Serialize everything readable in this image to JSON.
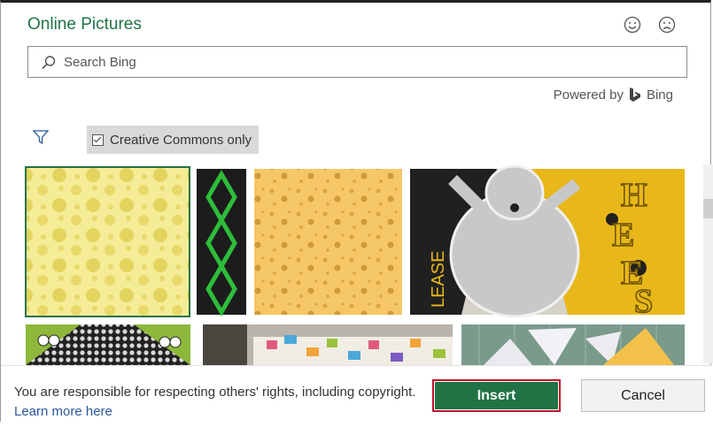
{
  "dialog": {
    "title": "Online Pictures",
    "smile_icon": "smiley-face-icon",
    "frown_icon": "frown-face-icon"
  },
  "search": {
    "placeholder": "Search Bing",
    "icon": "search-icon"
  },
  "powered_by": {
    "label": "Powered by",
    "brand": "Bing"
  },
  "filter": {
    "icon": "filter-icon",
    "creative_commons_label": "Creative Commons only",
    "creative_commons_checked": true
  },
  "results": [
    {
      "name": "yellow-polka-dot-image",
      "selected": true
    },
    {
      "name": "green-chain-image",
      "selected": false
    },
    {
      "name": "swiss-cheese-image",
      "selected": false
    },
    {
      "name": "cheese-mouse-card-image",
      "selected": false
    },
    {
      "name": "frog-fabric-image",
      "selected": false
    },
    {
      "name": "quilt-pattern-image",
      "selected": false
    },
    {
      "name": "fabric-triangles-image",
      "selected": false
    }
  ],
  "colors": {
    "accent": "#217346",
    "link": "#2b579a",
    "focus_border": "#c0102a"
  },
  "footer": {
    "notice": "You are responsible for respecting others' rights, including copyright.",
    "learn_more": "Learn more here",
    "insert_label": "Insert",
    "cancel_label": "Cancel"
  }
}
